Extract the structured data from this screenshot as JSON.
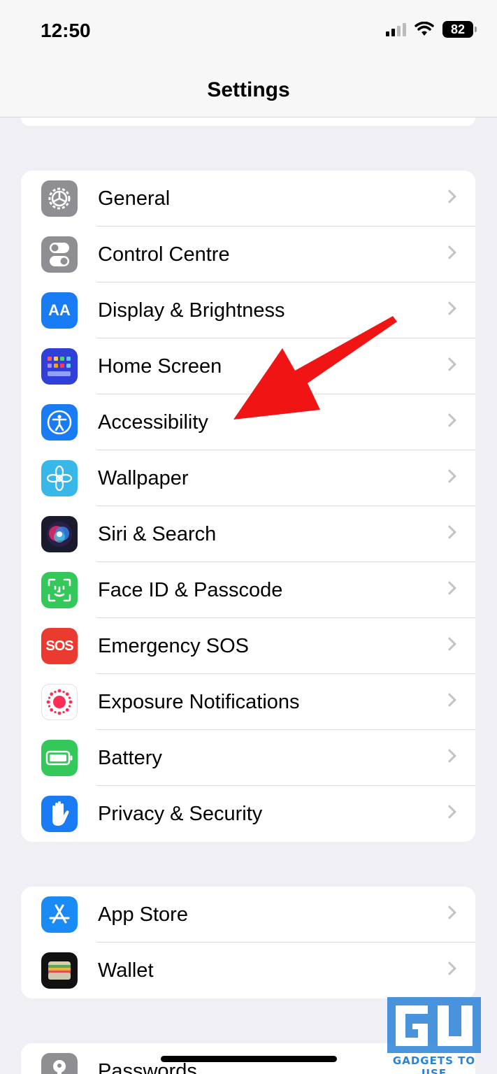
{
  "status_bar": {
    "time": "12:50",
    "battery": "82"
  },
  "nav": {
    "title": "Settings"
  },
  "groups": [
    {
      "items": [
        {
          "label": "General",
          "icon": "gear-icon",
          "color": "#8e8e93"
        },
        {
          "label": "Control Centre",
          "icon": "toggles-icon",
          "color": "#8e8e93"
        },
        {
          "label": "Display & Brightness",
          "icon": "text-size-icon",
          "color": "#1a7cf5"
        },
        {
          "label": "Home Screen",
          "icon": "app-grid-icon",
          "color": "#2f3fd8"
        },
        {
          "label": "Accessibility",
          "icon": "accessibility-icon",
          "color": "#1a7cf5"
        },
        {
          "label": "Wallpaper",
          "icon": "flower-icon",
          "color": "#38b8e8"
        },
        {
          "label": "Siri & Search",
          "icon": "siri-icon",
          "color": "#1b1b2e"
        },
        {
          "label": "Face ID & Passcode",
          "icon": "face-id-icon",
          "color": "#34c759"
        },
        {
          "label": "Emergency SOS",
          "icon": "sos-icon",
          "color": "#eb3b30"
        },
        {
          "label": "Exposure Notifications",
          "icon": "exposure-icon",
          "color": "#ffffff"
        },
        {
          "label": "Battery",
          "icon": "battery-icon",
          "color": "#34c759"
        },
        {
          "label": "Privacy & Security",
          "icon": "hand-icon",
          "color": "#1a7cf5"
        }
      ]
    },
    {
      "items": [
        {
          "label": "App Store",
          "icon": "app-store-icon",
          "color": "#1a8af5"
        },
        {
          "label": "Wallet",
          "icon": "wallet-icon",
          "color": "#111111"
        }
      ]
    },
    {
      "items": [
        {
          "label": "Passwords",
          "icon": "key-icon",
          "color": "#8e8e93"
        }
      ]
    }
  ],
  "watermark": {
    "text": "GADGETS TO USE"
  },
  "annotation": {
    "arrow_color": "#f01414"
  }
}
